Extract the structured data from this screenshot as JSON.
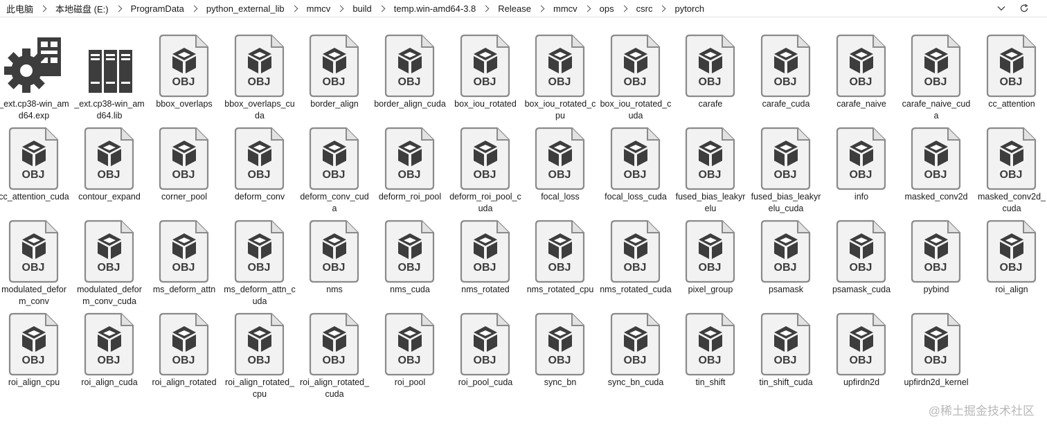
{
  "breadcrumb": [
    "此电脑",
    "本地磁盘 (E:)",
    "ProgramData",
    "python_external_lib",
    "mmcv",
    "build",
    "temp.win-amd64-3.8",
    "Release",
    "mmcv",
    "ops",
    "csrc",
    "pytorch"
  ],
  "address_bar_icons": [
    "chevron-down-icon",
    "refresh-icon"
  ],
  "files": [
    {
      "name": "_ext.cp38-win_amd64.exp",
      "icon": "exp-settings-icon"
    },
    {
      "name": "_ext.cp38-win_amd64.lib",
      "icon": "lib-books-icon"
    },
    {
      "name": "bbox_overlaps",
      "icon": "obj-file-icon",
      "label": "OBJ"
    },
    {
      "name": "bbox_overlaps_cuda",
      "icon": "obj-file-icon",
      "label": "OBJ"
    },
    {
      "name": "border_align",
      "icon": "obj-file-icon",
      "label": "OBJ"
    },
    {
      "name": "border_align_cuda",
      "icon": "obj-file-icon",
      "label": "OBJ"
    },
    {
      "name": "box_iou_rotated",
      "icon": "obj-file-icon",
      "label": "OBJ"
    },
    {
      "name": "box_iou_rotated_cpu",
      "icon": "obj-file-icon",
      "label": "OBJ"
    },
    {
      "name": "box_iou_rotated_cuda",
      "icon": "obj-file-icon",
      "label": "OBJ"
    },
    {
      "name": "carafe",
      "icon": "obj-file-icon",
      "label": "OBJ"
    },
    {
      "name": "carafe_cuda",
      "icon": "obj-file-icon",
      "label": "OBJ"
    },
    {
      "name": "carafe_naive",
      "icon": "obj-file-icon",
      "label": "OBJ"
    },
    {
      "name": "carafe_naive_cuda",
      "icon": "obj-file-icon",
      "label": "OBJ"
    },
    {
      "name": "cc_attention",
      "icon": "obj-file-icon",
      "label": "OBJ"
    },
    {
      "name": "cc_attention_cuda",
      "icon": "obj-file-icon",
      "label": "OBJ"
    },
    {
      "name": "contour_expand",
      "icon": "obj-file-icon",
      "label": "OBJ"
    },
    {
      "name": "corner_pool",
      "icon": "obj-file-icon",
      "label": "OBJ"
    },
    {
      "name": "deform_conv",
      "icon": "obj-file-icon",
      "label": "OBJ"
    },
    {
      "name": "deform_conv_cuda",
      "icon": "obj-file-icon",
      "label": "OBJ"
    },
    {
      "name": "deform_roi_pool",
      "icon": "obj-file-icon",
      "label": "OBJ"
    },
    {
      "name": "deform_roi_pool_cuda",
      "icon": "obj-file-icon",
      "label": "OBJ"
    },
    {
      "name": "focal_loss",
      "icon": "obj-file-icon",
      "label": "OBJ"
    },
    {
      "name": "focal_loss_cuda",
      "icon": "obj-file-icon",
      "label": "OBJ"
    },
    {
      "name": "fused_bias_leakyrelu",
      "icon": "obj-file-icon",
      "label": "OBJ"
    },
    {
      "name": "fused_bias_leakyrelu_cuda",
      "icon": "obj-file-icon",
      "label": "OBJ"
    },
    {
      "name": "info",
      "icon": "obj-file-icon",
      "label": "OBJ"
    },
    {
      "name": "masked_conv2d",
      "icon": "obj-file-icon",
      "label": "OBJ"
    },
    {
      "name": "masked_conv2d_cuda",
      "icon": "obj-file-icon",
      "label": "OBJ"
    },
    {
      "name": "modulated_deform_conv",
      "icon": "obj-file-icon",
      "label": "OBJ"
    },
    {
      "name": "modulated_deform_conv_cuda",
      "icon": "obj-file-icon",
      "label": "OBJ"
    },
    {
      "name": "ms_deform_attn",
      "icon": "obj-file-icon",
      "label": "OBJ"
    },
    {
      "name": "ms_deform_attn_cuda",
      "icon": "obj-file-icon",
      "label": "OBJ"
    },
    {
      "name": "nms",
      "icon": "obj-file-icon",
      "label": "OBJ"
    },
    {
      "name": "nms_cuda",
      "icon": "obj-file-icon",
      "label": "OBJ"
    },
    {
      "name": "nms_rotated",
      "icon": "obj-file-icon",
      "label": "OBJ"
    },
    {
      "name": "nms_rotated_cpu",
      "icon": "obj-file-icon",
      "label": "OBJ"
    },
    {
      "name": "nms_rotated_cuda",
      "icon": "obj-file-icon",
      "label": "OBJ"
    },
    {
      "name": "pixel_group",
      "icon": "obj-file-icon",
      "label": "OBJ"
    },
    {
      "name": "psamask",
      "icon": "obj-file-icon",
      "label": "OBJ"
    },
    {
      "name": "psamask_cuda",
      "icon": "obj-file-icon",
      "label": "OBJ"
    },
    {
      "name": "pybind",
      "icon": "obj-file-icon",
      "label": "OBJ"
    },
    {
      "name": "roi_align",
      "icon": "obj-file-icon",
      "label": "OBJ"
    },
    {
      "name": "roi_align_cpu",
      "icon": "obj-file-icon",
      "label": "OBJ"
    },
    {
      "name": "roi_align_cuda",
      "icon": "obj-file-icon",
      "label": "OBJ"
    },
    {
      "name": "roi_align_rotated",
      "icon": "obj-file-icon",
      "label": "OBJ"
    },
    {
      "name": "roi_align_rotated_cpu",
      "icon": "obj-file-icon",
      "label": "OBJ"
    },
    {
      "name": "roi_align_rotated_cuda",
      "icon": "obj-file-icon",
      "label": "OBJ"
    },
    {
      "name": "roi_pool",
      "icon": "obj-file-icon",
      "label": "OBJ"
    },
    {
      "name": "roi_pool_cuda",
      "icon": "obj-file-icon",
      "label": "OBJ"
    },
    {
      "name": "sync_bn",
      "icon": "obj-file-icon",
      "label": "OBJ"
    },
    {
      "name": "sync_bn_cuda",
      "icon": "obj-file-icon",
      "label": "OBJ"
    },
    {
      "name": "tin_shift",
      "icon": "obj-file-icon",
      "label": "OBJ"
    },
    {
      "name": "tin_shift_cuda",
      "icon": "obj-file-icon",
      "label": "OBJ"
    },
    {
      "name": "upfirdn2d",
      "icon": "obj-file-icon",
      "label": "OBJ"
    },
    {
      "name": "upfirdn2d_kernel",
      "icon": "obj-file-icon",
      "label": "OBJ"
    }
  ],
  "watermark": "@稀土掘金技术社区",
  "colors": {
    "icon_dark": "#3d3d3d",
    "icon_page_fill": "#f2f2f2",
    "icon_page_border": "#8a8a8a",
    "text": "#1a1a1a",
    "watermark": "#b8b8b8"
  }
}
